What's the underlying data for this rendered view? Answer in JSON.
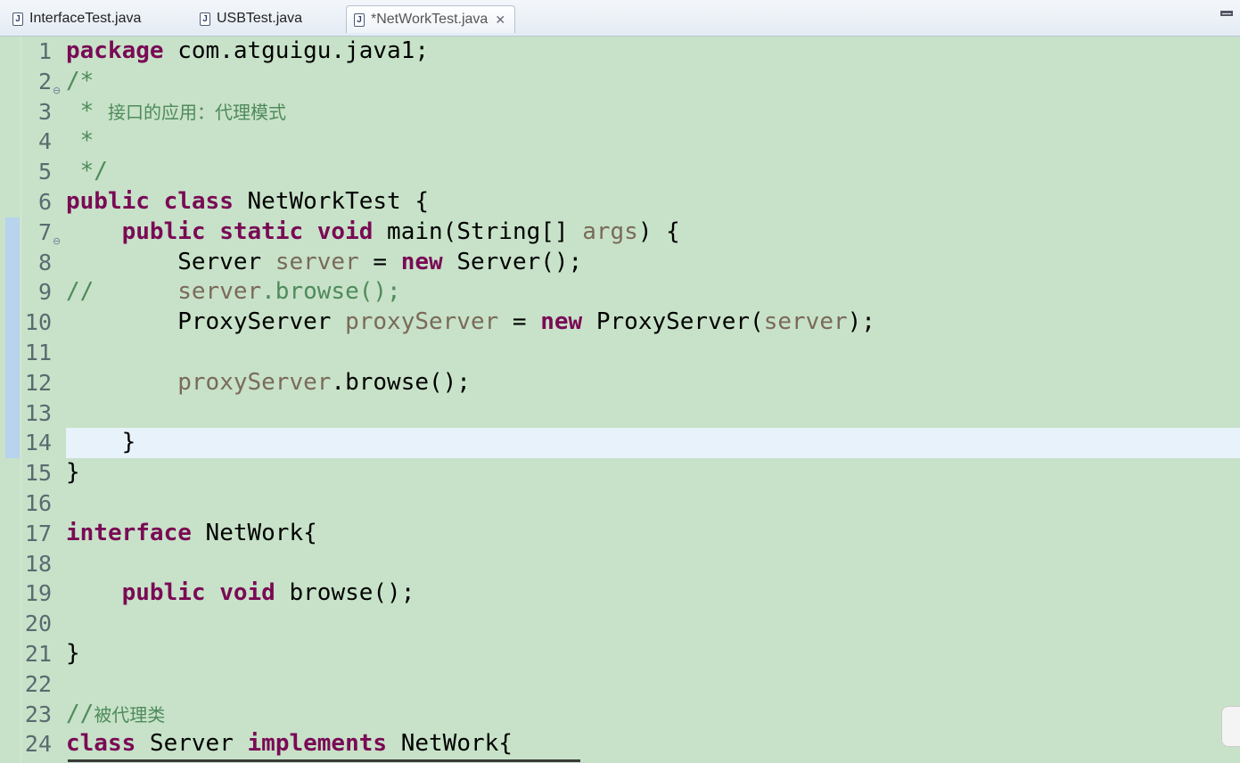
{
  "tabs": [
    {
      "label": "InterfaceTest.java",
      "active": false
    },
    {
      "label": "USBTest.java",
      "active": false
    },
    {
      "label": "*NetWorkTest.java",
      "active": true
    }
  ],
  "icons": {
    "file": "java-file-icon",
    "close": "close-icon",
    "minimize": "minimize-icon",
    "fold": "fold-toggle-icon"
  },
  "colors": {
    "background": "#c7e2c8",
    "keyword": "#7a0a55",
    "comment": "#4f8a5b",
    "variable": "#7a6a5a",
    "current_line": "#e8f2fb"
  },
  "current_line": 14,
  "lines": [
    {
      "num": "1",
      "segs": [
        [
          "kw",
          "package"
        ],
        [
          "t",
          " com.atguigu.java1;"
        ]
      ]
    },
    {
      "num": "2",
      "fold": true,
      "segs": [
        [
          "com",
          "/*"
        ]
      ]
    },
    {
      "num": "3",
      "segs": [
        [
          "com",
          " * "
        ],
        [
          "cjk",
          "接口的应用：代理模式"
        ]
      ]
    },
    {
      "num": "4",
      "segs": [
        [
          "com",
          " *"
        ]
      ]
    },
    {
      "num": "5",
      "segs": [
        [
          "com",
          " */"
        ]
      ]
    },
    {
      "num": "6",
      "segs": [
        [
          "kw",
          "public"
        ],
        [
          "t",
          " "
        ],
        [
          "kw",
          "class"
        ],
        [
          "t",
          " NetWorkTest {"
        ]
      ]
    },
    {
      "num": "7",
      "fold": true,
      "changed": true,
      "segs": [
        [
          "t",
          "    "
        ],
        [
          "kw",
          "public"
        ],
        [
          "t",
          " "
        ],
        [
          "kw",
          "static"
        ],
        [
          "t",
          " "
        ],
        [
          "kw",
          "void"
        ],
        [
          "t",
          " main(String[] "
        ],
        [
          "var",
          "args"
        ],
        [
          "t",
          ") {"
        ]
      ]
    },
    {
      "num": "8",
      "changed": true,
      "segs": [
        [
          "t",
          "        Server "
        ],
        [
          "var",
          "server"
        ],
        [
          "t",
          " = "
        ],
        [
          "kw",
          "new"
        ],
        [
          "t",
          " Server();"
        ]
      ]
    },
    {
      "num": "9",
      "changed": true,
      "segs": [
        [
          "com",
          "//      "
        ],
        [
          "var",
          "server"
        ],
        [
          "com",
          ".browse();"
        ]
      ]
    },
    {
      "num": "10",
      "changed": true,
      "segs": [
        [
          "t",
          "        ProxyServer "
        ],
        [
          "var",
          "proxyServer"
        ],
        [
          "t",
          " = "
        ],
        [
          "kw",
          "new"
        ],
        [
          "t",
          " ProxyServer("
        ],
        [
          "var",
          "server"
        ],
        [
          "t",
          ");"
        ]
      ]
    },
    {
      "num": "11",
      "changed": true,
      "segs": [
        [
          "t",
          ""
        ]
      ]
    },
    {
      "num": "12",
      "changed": true,
      "segs": [
        [
          "t",
          "        "
        ],
        [
          "var",
          "proxyServer"
        ],
        [
          "t",
          ".browse();"
        ]
      ]
    },
    {
      "num": "13",
      "changed": true,
      "segs": [
        [
          "t",
          ""
        ]
      ]
    },
    {
      "num": "14",
      "changed": true,
      "segs": [
        [
          "t",
          "    }"
        ]
      ]
    },
    {
      "num": "15",
      "segs": [
        [
          "t",
          "}"
        ]
      ]
    },
    {
      "num": "16",
      "segs": [
        [
          "t",
          ""
        ]
      ]
    },
    {
      "num": "17",
      "segs": [
        [
          "kw",
          "interface"
        ],
        [
          "t",
          " NetWork{"
        ]
      ]
    },
    {
      "num": "18",
      "segs": [
        [
          "t",
          ""
        ]
      ]
    },
    {
      "num": "19",
      "segs": [
        [
          "t",
          "    "
        ],
        [
          "kw",
          "public"
        ],
        [
          "t",
          " "
        ],
        [
          "kw",
          "void"
        ],
        [
          "t",
          " browse();"
        ]
      ]
    },
    {
      "num": "20",
      "segs": [
        [
          "t",
          ""
        ]
      ]
    },
    {
      "num": "21",
      "segs": [
        [
          "t",
          "}"
        ]
      ]
    },
    {
      "num": "22",
      "segs": [
        [
          "t",
          ""
        ]
      ]
    },
    {
      "num": "23",
      "segs": [
        [
          "com",
          "//"
        ],
        [
          "cjk",
          "被代理类"
        ]
      ]
    },
    {
      "num": "24",
      "segs": [
        [
          "kw",
          "class"
        ],
        [
          "t",
          " Server "
        ],
        [
          "kw",
          "implements"
        ],
        [
          "t",
          " NetWork{"
        ]
      ]
    }
  ]
}
